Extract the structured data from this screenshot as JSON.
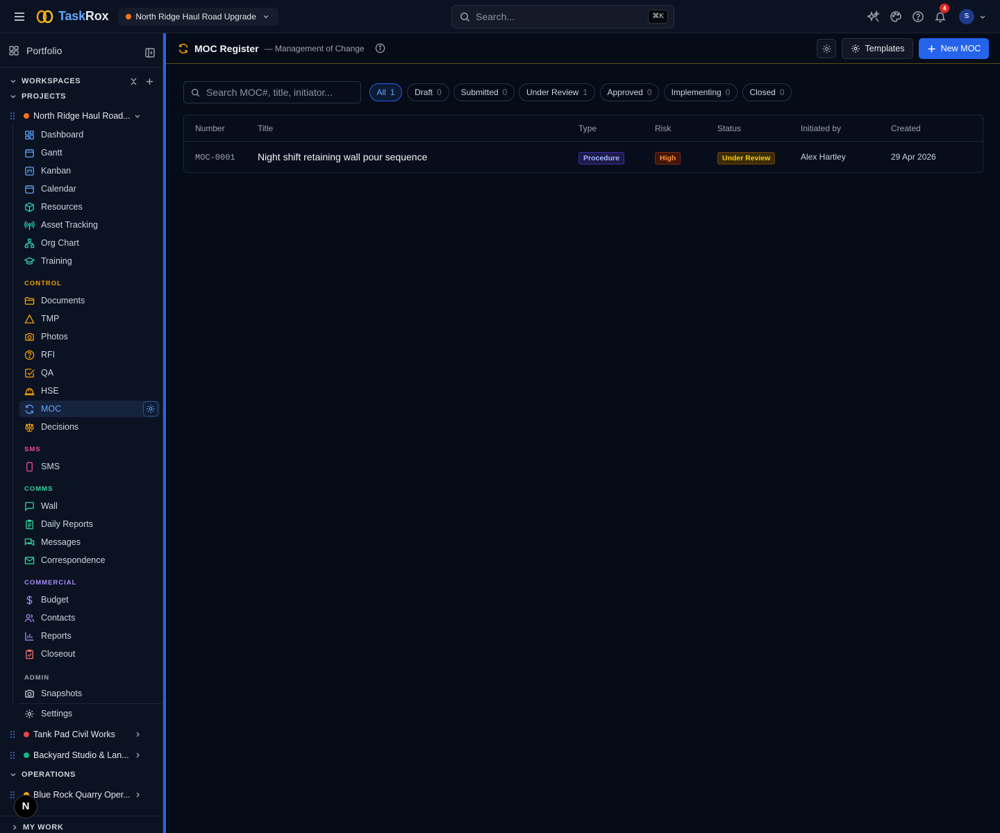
{
  "app": {
    "logo_part1": "Task",
    "logo_part2": "Rox"
  },
  "topbar": {
    "project_selector": "North Ridge Haul Road Upgrade",
    "search_placeholder": "Search...",
    "search_shortcut": "⌘K",
    "notification_count": "4",
    "user_initial": "S"
  },
  "sidebar": {
    "portfolio_label": "Portfolio",
    "workspaces_label": "WORKSPACES",
    "projects_label": "PROJECTS",
    "current_project": "North Ridge Haul Road...",
    "nav": [
      {
        "label": "Dashboard",
        "icon": "dashboard-icon"
      },
      {
        "label": "Gantt",
        "icon": "gantt-icon"
      },
      {
        "label": "Kanban",
        "icon": "kanban-icon"
      },
      {
        "label": "Calendar",
        "icon": "calendar-icon"
      },
      {
        "label": "Resources",
        "icon": "box-icon"
      },
      {
        "label": "Asset Tracking",
        "icon": "radio-tower-icon"
      },
      {
        "label": "Org Chart",
        "icon": "org-chart-icon"
      },
      {
        "label": "Training",
        "icon": "graduation-cap-icon"
      }
    ],
    "control_label": "CONTROL",
    "control": [
      {
        "label": "Documents",
        "icon": "folder-icon"
      },
      {
        "label": "TMP",
        "icon": "triangle-icon"
      },
      {
        "label": "Photos",
        "icon": "camera-icon"
      },
      {
        "label": "RFI",
        "icon": "question-icon"
      },
      {
        "label": "QA",
        "icon": "check-square-icon"
      },
      {
        "label": "HSE",
        "icon": "hard-hat-icon"
      },
      {
        "label": "MOC",
        "icon": "refresh-icon"
      },
      {
        "label": "Decisions",
        "icon": "scale-icon"
      }
    ],
    "sms_label": "SMS",
    "sms": [
      {
        "label": "SMS",
        "icon": "phone-icon"
      }
    ],
    "comms_label": "COMMS",
    "comms": [
      {
        "label": "Wall",
        "icon": "message-square-icon"
      },
      {
        "label": "Daily Reports",
        "icon": "clipboard-icon"
      },
      {
        "label": "Messages",
        "icon": "messages-icon"
      },
      {
        "label": "Correspondence",
        "icon": "mail-icon"
      }
    ],
    "commercial_label": "COMMERCIAL",
    "commercial": [
      {
        "label": "Budget",
        "icon": "dollar-icon"
      },
      {
        "label": "Contacts",
        "icon": "users-icon"
      },
      {
        "label": "Reports",
        "icon": "bar-chart-icon"
      },
      {
        "label": "Closeout",
        "icon": "clipboard-check-icon"
      }
    ],
    "admin_label": "ADMIN",
    "admin": [
      {
        "label": "Snapshots",
        "icon": "camera-icon"
      }
    ],
    "settings_label": "Settings",
    "other_projects": [
      {
        "label": "Tank Pad Civil Works",
        "color": "#ef4444"
      },
      {
        "label": "Backyard Studio & Lan...",
        "color": "#10b981"
      }
    ],
    "operations_label": "OPERATIONS",
    "operations_project": "Blue Rock Quarry Oper...",
    "my_work_label": "MY WORK",
    "fab_label": "N"
  },
  "main": {
    "title": "MOC Register",
    "subtitle": "— Management of Change",
    "templates_label": "Templates",
    "new_label": "New MOC",
    "search_placeholder": "Search MOC#, title, initiator...",
    "filters": [
      {
        "label": "All",
        "count": "1"
      },
      {
        "label": "Draft",
        "count": "0"
      },
      {
        "label": "Submitted",
        "count": "0"
      },
      {
        "label": "Under Review",
        "count": "1"
      },
      {
        "label": "Approved",
        "count": "0"
      },
      {
        "label": "Implementing",
        "count": "0"
      },
      {
        "label": "Closed",
        "count": "0"
      }
    ],
    "columns": [
      "Number",
      "Title",
      "Type",
      "Risk",
      "Status",
      "Initiated by",
      "Created"
    ],
    "rows": [
      {
        "number": "MOC-0001",
        "title": "Night shift retaining wall pour sequence",
        "type": "Procedure",
        "risk": "High",
        "status": "Under Review",
        "initiated_by": "Alex Hartley",
        "created": "29 Apr 2026"
      }
    ]
  }
}
